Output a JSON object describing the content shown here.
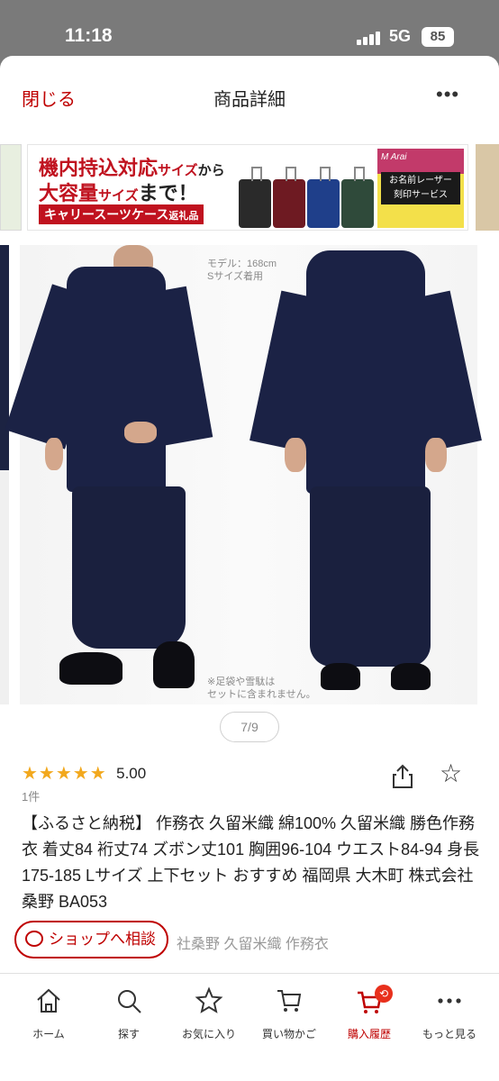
{
  "status_bar": {
    "time": "11:18",
    "network": "5G",
    "battery": "85"
  },
  "header": {
    "close_label": "閉じる",
    "title": "商品詳細",
    "more_label": "•••"
  },
  "banner": {
    "line1_main": "機内持込対応",
    "line1_sub": "サイズ",
    "line1_tail": "から",
    "line2_main": "大容量",
    "line2_sub": "サイズ",
    "line2_tail": "まで！",
    "chip_main": "キャリースーツケース",
    "chip_sub": "返礼品",
    "brand_script": "M Arai",
    "laser_line1": "お名前レーザー",
    "laser_line2": "刻印サービス"
  },
  "image": {
    "model_note_line1": "モデル：168cm",
    "model_note_line2": "Sサイズ着用",
    "accessory_note_line1": "※足袋や雪駄は",
    "accessory_note_line2": "セットに含まれません。",
    "page_indicator": "7/9"
  },
  "product": {
    "stars": "★★★★★",
    "rating": "5.00",
    "review_count": "1件",
    "title": "【ふるさと納税】 作務衣 久留米織 綿100% 久留米織 勝色作務衣 着丈84 裄丈74 ズボン丈101 胸囲96-104 ウエスト84-94 身長175-185 Lサイズ 上下セット おすすめ 福岡県 大木町 株式会社桑野 BA053",
    "shop_tags": "社桑野 久留米織 作務衣"
  },
  "consult": {
    "label": "ショップへ相談"
  },
  "nav": {
    "items": [
      {
        "label": "ホーム",
        "icon": "home-icon"
      },
      {
        "label": "探す",
        "icon": "search-icon"
      },
      {
        "label": "お気に入り",
        "icon": "star-icon"
      },
      {
        "label": "買い物かご",
        "icon": "cart-icon"
      },
      {
        "label": "購入履歴",
        "icon": "purchase-history-icon"
      },
      {
        "label": "もっと見る",
        "icon": "more-icon"
      }
    ]
  },
  "colors": {
    "accent": "#bf0000",
    "star": "#f2a81d",
    "garment": "#1b2245"
  }
}
